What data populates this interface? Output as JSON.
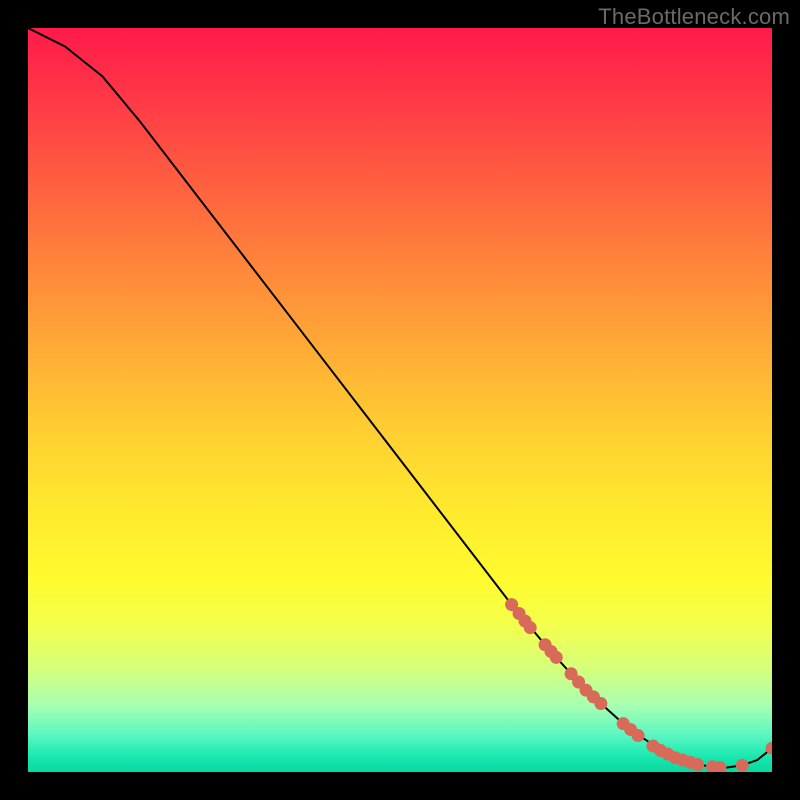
{
  "watermark": "TheBottleneck.com",
  "colors": {
    "background": "#000000",
    "curve": "#000000",
    "marker_fill": "#d86a5a",
    "marker_stroke": "#b84838"
  },
  "chart_data": {
    "type": "line",
    "title": "",
    "xlabel": "",
    "ylabel": "",
    "xlim": [
      0,
      100
    ],
    "ylim": [
      0,
      100
    ],
    "grid": false,
    "legend": false,
    "note": "No axis tick labels are printed; values below are read off the plot proportionally (0–100 scale on both axes).",
    "series": [
      {
        "name": "curve",
        "x": [
          0,
          5,
          10,
          15,
          20,
          25,
          30,
          35,
          40,
          45,
          50,
          55,
          60,
          65,
          70,
          75,
          80,
          82,
          85,
          88,
          90,
          92,
          94,
          96,
          98,
          100
        ],
        "y": [
          100,
          97.5,
          93.5,
          87.5,
          81,
          74.5,
          68,
          61.5,
          55,
          48.5,
          42,
          35.5,
          29,
          22.5,
          16.5,
          11,
          6.5,
          5,
          3,
          1.6,
          1.0,
          0.7,
          0.6,
          0.9,
          1.6,
          3.2
        ]
      }
    ],
    "markers": {
      "name": "scatter-points",
      "note": "Salmon dots lying on the curve, clustered on the right half.",
      "points": [
        {
          "x": 65,
          "y": 22.5
        },
        {
          "x": 66,
          "y": 21.3
        },
        {
          "x": 66.8,
          "y": 20.3
        },
        {
          "x": 67.5,
          "y": 19.4
        },
        {
          "x": 69.5,
          "y": 17.1
        },
        {
          "x": 70.3,
          "y": 16.2
        },
        {
          "x": 71,
          "y": 15.4
        },
        {
          "x": 73,
          "y": 13.2
        },
        {
          "x": 74,
          "y": 12.1
        },
        {
          "x": 75,
          "y": 11.0
        },
        {
          "x": 76,
          "y": 10.1
        },
        {
          "x": 77,
          "y": 9.2
        },
        {
          "x": 80,
          "y": 6.5
        },
        {
          "x": 81,
          "y": 5.7
        },
        {
          "x": 82,
          "y": 4.9
        },
        {
          "x": 84,
          "y": 3.5
        },
        {
          "x": 85,
          "y": 2.9
        },
        {
          "x": 86,
          "y": 2.4
        },
        {
          "x": 87,
          "y": 1.9
        },
        {
          "x": 88,
          "y": 1.6
        },
        {
          "x": 89,
          "y": 1.3
        },
        {
          "x": 90,
          "y": 1.0
        },
        {
          "x": 92,
          "y": 0.7
        },
        {
          "x": 93,
          "y": 0.6
        },
        {
          "x": 96,
          "y": 0.9
        },
        {
          "x": 100,
          "y": 3.2
        }
      ]
    }
  }
}
